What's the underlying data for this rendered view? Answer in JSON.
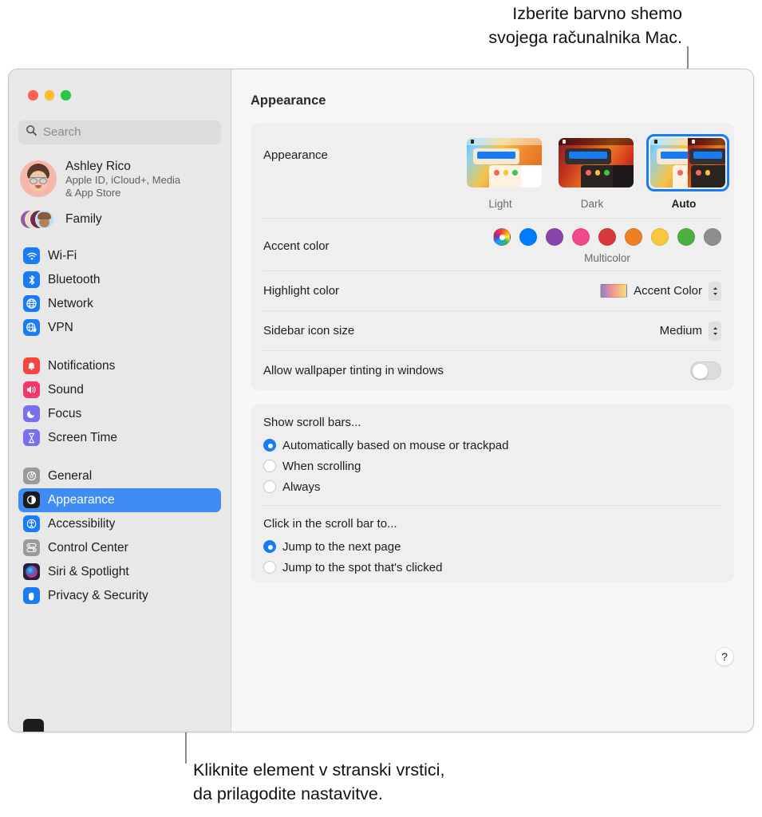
{
  "callouts": {
    "top_line1": "Izberite barvno shemo",
    "top_line2": "svojega računalnika Mac.",
    "bottom_line1": "Kliknite element v stranski vrstici,",
    "bottom_line2": "da prilagodite nastavitve."
  },
  "window": {
    "title": "Appearance"
  },
  "sidebar": {
    "search": {
      "placeholder": "Search",
      "icon": "search-icon"
    },
    "account": {
      "name": "Ashley Rico",
      "subtitle_line1": "Apple ID, iCloud+, Media",
      "subtitle_line2": "& App Store"
    },
    "family": {
      "label": "Family"
    },
    "groups": [
      {
        "items": [
          {
            "label": "Wi-Fi",
            "icon": "wifi-icon",
            "color": "#1a7cf5",
            "selected": false
          },
          {
            "label": "Bluetooth",
            "icon": "bluetooth-icon",
            "color": "#1a7cf5",
            "selected": false
          },
          {
            "label": "Network",
            "icon": "globe-icon",
            "color": "#1a7cf5",
            "selected": false
          },
          {
            "label": "VPN",
            "icon": "vpn-globe-icon",
            "color": "#1a7cf5",
            "selected": false
          }
        ]
      },
      {
        "items": [
          {
            "label": "Notifications",
            "icon": "bell-icon",
            "color": "#f4463c",
            "selected": false
          },
          {
            "label": "Sound",
            "icon": "speaker-icon",
            "color": "#f4366b",
            "selected": false
          },
          {
            "label": "Focus",
            "icon": "moon-icon",
            "color": "#7a6ff0",
            "selected": false
          },
          {
            "label": "Screen Time",
            "icon": "hourglass-icon",
            "color": "#7a6ff0",
            "selected": false
          }
        ]
      },
      {
        "items": [
          {
            "label": "General",
            "icon": "gear-icon",
            "color": "#9a9a9a",
            "selected": false
          },
          {
            "label": "Appearance",
            "icon": "appearance-icon",
            "color": "#1c1c1c",
            "selected": true
          },
          {
            "label": "Accessibility",
            "icon": "accessibility-icon",
            "color": "#1a7cf5",
            "selected": false
          },
          {
            "label": "Control Center",
            "icon": "control-center-icon",
            "color": "#9a9a9a",
            "selected": false
          },
          {
            "label": "Siri & Spotlight",
            "icon": "siri-icon",
            "color": "#3a2a55",
            "selected": false
          },
          {
            "label": "Privacy & Security",
            "icon": "hand-icon",
            "color": "#1a7cf5",
            "selected": false
          }
        ]
      }
    ]
  },
  "main": {
    "appearance_row": {
      "label": "Appearance",
      "options": [
        {
          "label": "Light",
          "selected": false
        },
        {
          "label": "Dark",
          "selected": false
        },
        {
          "label": "Auto",
          "selected": true
        }
      ]
    },
    "accent_row": {
      "label": "Accent color",
      "caption": "Multicolor",
      "swatches": [
        {
          "name": "multicolor",
          "color": "multicolor",
          "selected": true
        },
        {
          "name": "blue",
          "color": "#007aff",
          "selected": false
        },
        {
          "name": "purple",
          "color": "#8944ab",
          "selected": false
        },
        {
          "name": "pink",
          "color": "#f2498c",
          "selected": false
        },
        {
          "name": "red",
          "color": "#d63a3a",
          "selected": false
        },
        {
          "name": "orange",
          "color": "#ee8023",
          "selected": false
        },
        {
          "name": "yellow",
          "color": "#f7c83c",
          "selected": false
        },
        {
          "name": "green",
          "color": "#4caf42",
          "selected": false
        },
        {
          "name": "graphite",
          "color": "#8e8e8e",
          "selected": false
        }
      ]
    },
    "highlight_row": {
      "label": "Highlight color",
      "value": "Accent Color"
    },
    "sidebar_size_row": {
      "label": "Sidebar icon size",
      "value": "Medium"
    },
    "tinting_row": {
      "label": "Allow wallpaper tinting in windows",
      "enabled": false
    },
    "scrollbars": {
      "title": "Show scroll bars...",
      "options": [
        {
          "label": "Automatically based on mouse or trackpad",
          "selected": true
        },
        {
          "label": "When scrolling",
          "selected": false
        },
        {
          "label": "Always",
          "selected": false
        }
      ]
    },
    "scrollbar_click": {
      "title": "Click in the scroll bar to...",
      "options": [
        {
          "label": "Jump to the next page",
          "selected": true
        },
        {
          "label": "Jump to the spot that's clicked",
          "selected": false
        }
      ]
    },
    "help_button": "?"
  }
}
